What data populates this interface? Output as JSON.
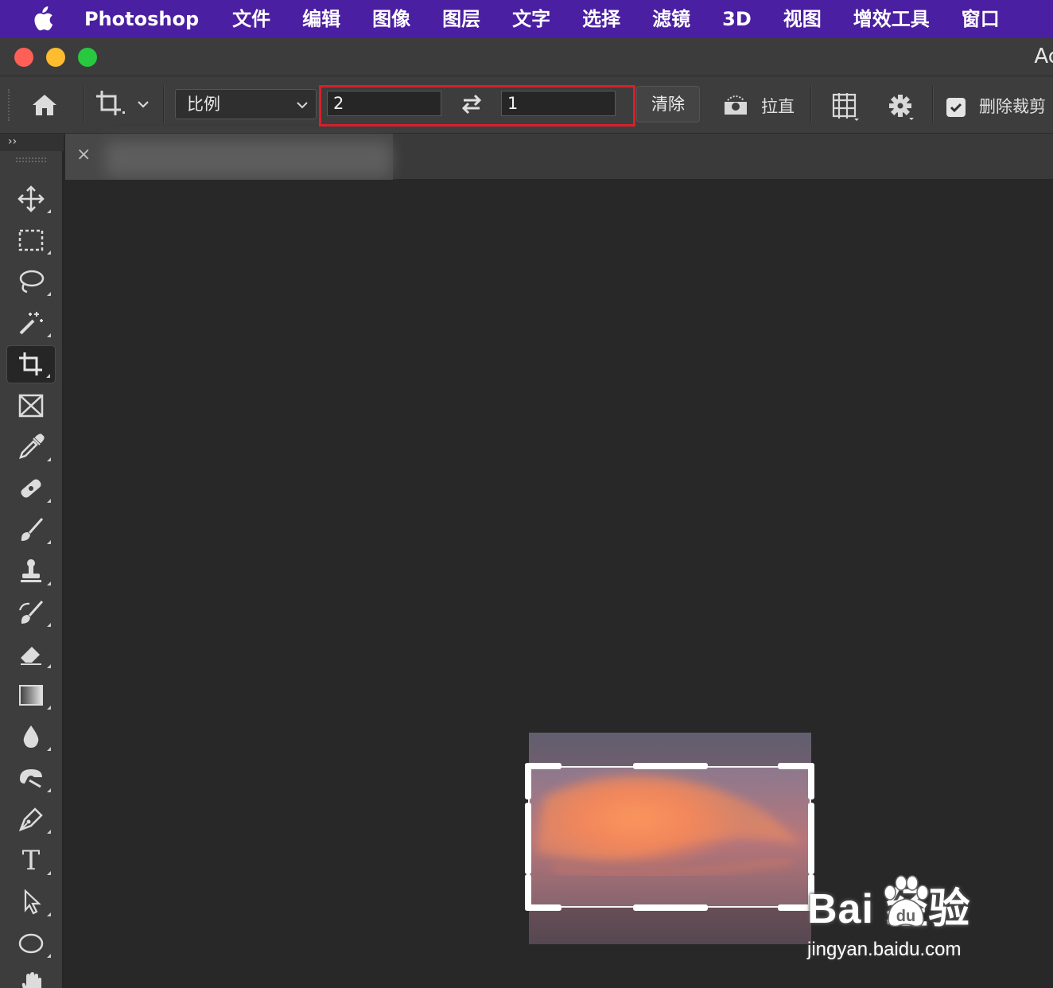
{
  "menubar": {
    "app_name": "Photoshop",
    "items": [
      "文件",
      "编辑",
      "图像",
      "图层",
      "文字",
      "选择",
      "滤镜",
      "3D",
      "视图",
      "增效工具",
      "窗口"
    ]
  },
  "window": {
    "title_partial": "Ac"
  },
  "options_bar": {
    "aspect_preset": "比例",
    "ratio_width": "2",
    "ratio_height": "1",
    "clear_label": "清除",
    "straighten_label": "拉直",
    "delete_cropped_label": "删除裁剪",
    "delete_cropped_checked": true,
    "highlight_color": "#d8202a"
  },
  "tools": [
    {
      "name": "move-tool",
      "icon": "move-icon"
    },
    {
      "name": "marquee-tool",
      "icon": "rect-marquee-icon"
    },
    {
      "name": "lasso-tool",
      "icon": "lasso-icon"
    },
    {
      "name": "magic-wand-tool",
      "icon": "magic-wand-icon"
    },
    {
      "name": "crop-tool",
      "icon": "crop-icon",
      "active": true
    },
    {
      "name": "frame-tool",
      "icon": "frame-icon"
    },
    {
      "name": "eyedropper-tool",
      "icon": "eyedropper-icon"
    },
    {
      "name": "healing-tool",
      "icon": "bandage-icon"
    },
    {
      "name": "brush-tool",
      "icon": "brush-icon"
    },
    {
      "name": "stamp-tool",
      "icon": "stamp-icon"
    },
    {
      "name": "history-brush-tool",
      "icon": "history-brush-icon"
    },
    {
      "name": "eraser-tool",
      "icon": "eraser-icon"
    },
    {
      "name": "gradient-tool",
      "icon": "gradient-icon"
    },
    {
      "name": "blur-tool",
      "icon": "drop-icon"
    },
    {
      "name": "dodge-tool",
      "icon": "dodge-icon"
    },
    {
      "name": "pen-tool",
      "icon": "pen-icon"
    },
    {
      "name": "type-tool",
      "icon": "type-icon",
      "glyph": "T"
    },
    {
      "name": "path-select-tool",
      "icon": "arrow-icon"
    },
    {
      "name": "ellipse-tool",
      "icon": "ellipse-icon"
    },
    {
      "name": "hand-tool",
      "icon": "hand-icon"
    }
  ],
  "document_tab": {
    "close_glyph": "×",
    "name_blurred": true
  },
  "watermark": {
    "brand": "Bai 经验",
    "url": "jingyan.baidu.com"
  },
  "colors": {
    "menubar_bg": "#4b1fa1",
    "panel_bg": "#3d3d3d",
    "canvas_bg": "#282828"
  }
}
